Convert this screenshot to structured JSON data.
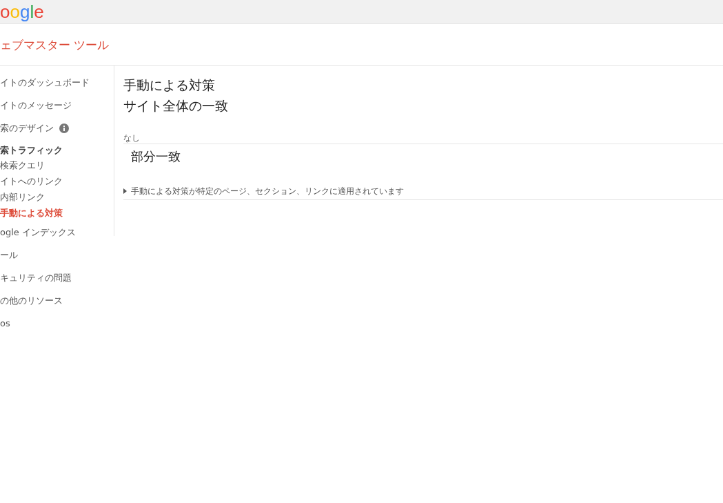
{
  "header": {
    "logo": "oogle"
  },
  "app_title": "ェブマスター ツール",
  "sidebar": {
    "items": [
      {
        "kind": "item",
        "label": "イトのダッシュボード",
        "selected": false
      },
      {
        "kind": "item",
        "label": "イトのメッセージ",
        "selected": false
      },
      {
        "kind": "item",
        "label": "索のデザイン",
        "selected": false,
        "info": true
      },
      {
        "kind": "heading",
        "label": "索トラフィック",
        "selected": false
      },
      {
        "kind": "subitem",
        "label": "検索クエリ",
        "selected": false
      },
      {
        "kind": "subitem",
        "label": "イトへのリンク",
        "selected": false
      },
      {
        "kind": "subitem",
        "label": "内部リンク",
        "selected": false
      },
      {
        "kind": "subitem",
        "label": "手動による対策",
        "selected": true
      },
      {
        "kind": "item",
        "label": "ogle インデックス",
        "selected": false
      },
      {
        "kind": "item",
        "label": "ール",
        "selected": false
      },
      {
        "kind": "item",
        "label": "キュリティの問題",
        "selected": false
      },
      {
        "kind": "item",
        "label": "の他のリソース",
        "selected": false
      },
      {
        "kind": "item",
        "label": "os",
        "selected": false
      }
    ]
  },
  "main": {
    "title": "手動による対策",
    "sections": [
      {
        "heading": "サイト全体の一致",
        "status": "なし"
      },
      {
        "heading": "部分一致",
        "expander": {
          "label": "手動による対策が特定のページ、セクション、リンクに適用されています",
          "expanded": false
        }
      }
    ]
  }
}
